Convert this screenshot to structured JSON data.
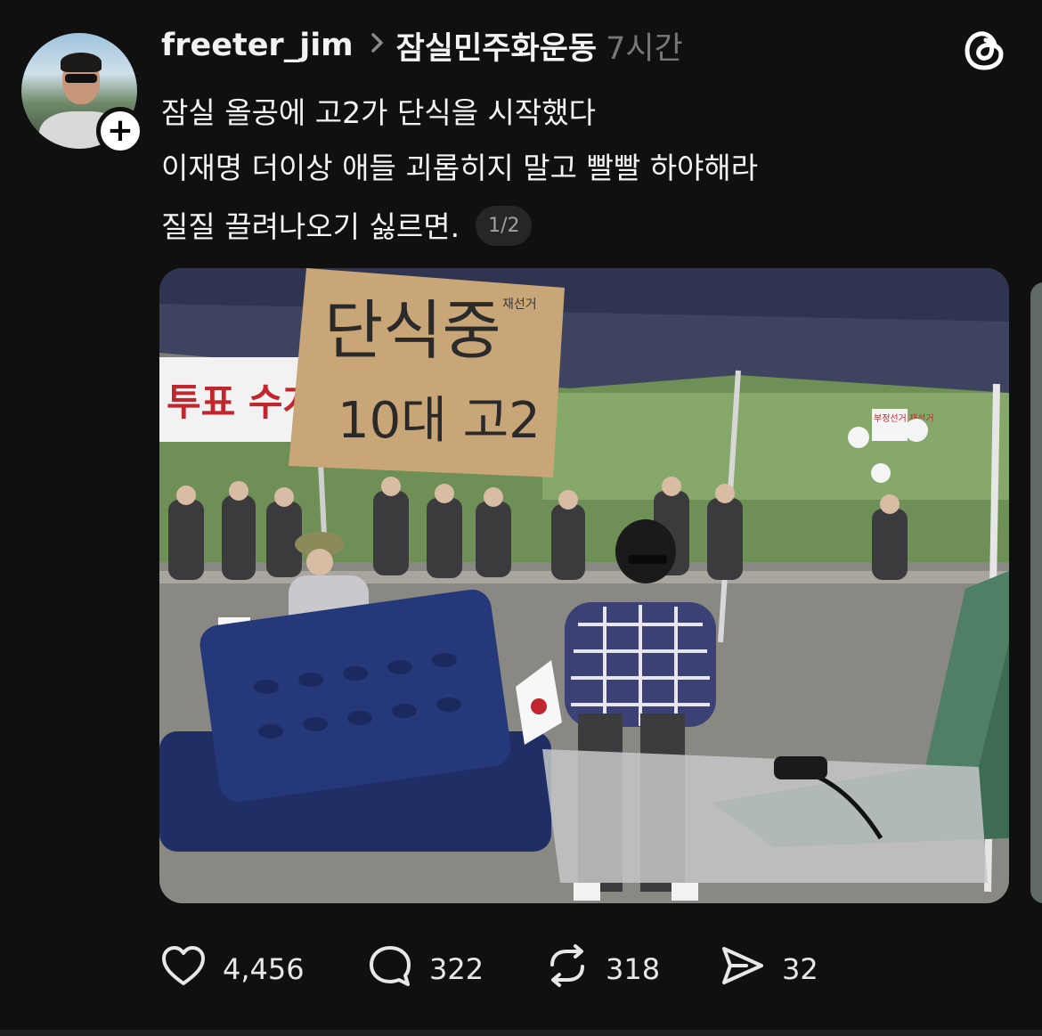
{
  "post": {
    "username": "freeter_jim",
    "community": "잠실민주화운동",
    "time": "7시간",
    "lines": [
      "잠실 올공에 고2가 단식을 시작했다",
      "이재명 더이상 애들 괴롭히지 말고 빨빨 하야해라",
      "질질 끌려나오기 싫르면."
    ],
    "pager": "1/2",
    "photo": {
      "sign_line1": "단식중",
      "sign_line2": "10대 고2",
      "sign_small": "재선거",
      "banner_text": "투표 수개표",
      "small_sign": "부정선거 재선거"
    }
  },
  "actions": {
    "likes": "4,456",
    "comments": "322",
    "reposts": "318",
    "shares": "32"
  },
  "icons": [
    "plus-icon",
    "chevron-right-icon",
    "threads-logo-icon",
    "heart-icon",
    "comment-icon",
    "repost-icon",
    "send-icon"
  ],
  "colors": {
    "background": "#101010",
    "text": "#f3f3f3",
    "muted": "#777777",
    "pager_bg": "#262626"
  }
}
